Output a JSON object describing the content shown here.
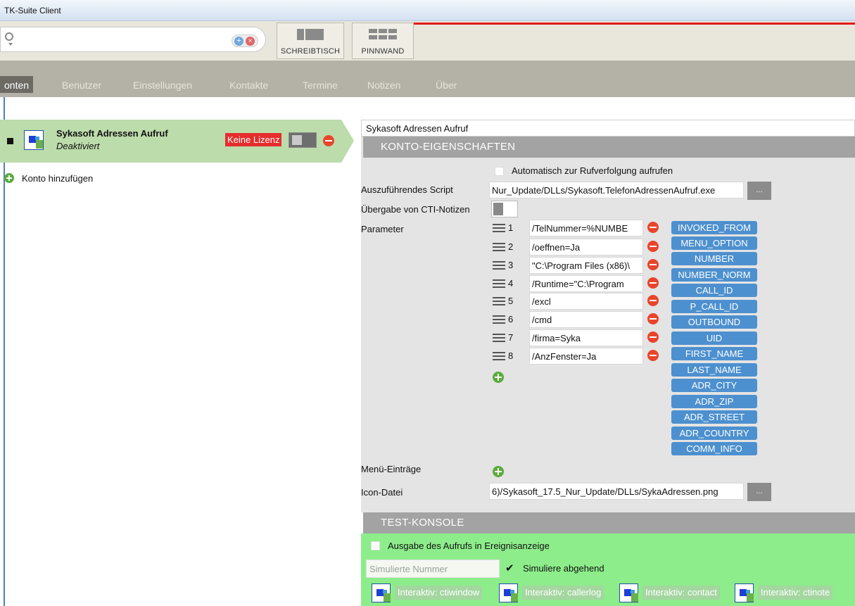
{
  "window": {
    "title": "TK-Suite Client"
  },
  "toolbar": {
    "view_buttons": [
      {
        "label": "SCHREIBTISCH",
        "icon": "desk-view-icon"
      },
      {
        "label": "PINNWAND",
        "icon": "pinboard-view-icon"
      }
    ],
    "search": {
      "placeholder": ""
    }
  },
  "tabs": [
    {
      "label": "onten",
      "active": true
    },
    {
      "label": "Benutzer",
      "active": false
    },
    {
      "label": "Einstellungen",
      "active": false
    },
    {
      "label": "Kontakte",
      "active": false
    },
    {
      "label": "Termine",
      "active": false
    },
    {
      "label": "Notizen",
      "active": false
    },
    {
      "label": "Über",
      "active": false
    }
  ],
  "accounts": [
    {
      "name": "Sykasoft Adressen Aufruf",
      "status": "Deaktiviert",
      "license_badge": "Keine Lizenz",
      "enabled": false
    }
  ],
  "add_account_label": "Konto hinzufügen",
  "details": {
    "title": "Sykasoft Adressen Aufruf",
    "section_header": "KONTO-EIGENSCHAFTEN",
    "auto_call_label": "Automatisch zur Rufverfolgung aufrufen",
    "script_label": "Auszuführendes Script",
    "script_value": "Nur_Update/DLLs/Sykasoft.TelefonAdressenAufruf.exe",
    "browse_label": "...",
    "cti_notes_label": "Übergabe von CTI-Notizen",
    "parameter_label": "Parameter",
    "parameters": [
      {
        "num": "1",
        "value": "/TelNummer=%NUMBE"
      },
      {
        "num": "2",
        "value": "/oeffnen=Ja"
      },
      {
        "num": "3",
        "value": "\"C:\\Program Files (x86)\\"
      },
      {
        "num": "4",
        "value": "/Runtime=\"C:\\Program"
      },
      {
        "num": "5",
        "value": "/excl"
      },
      {
        "num": "6",
        "value": "/cmd"
      },
      {
        "num": "7",
        "value": "/firma=Syka"
      },
      {
        "num": "8",
        "value": "/AnzFenster=Ja"
      }
    ],
    "variables": [
      "INVOKED_FROM",
      "MENU_OPTION",
      "NUMBER",
      "NUMBER_NORM",
      "CALL_ID",
      "P_CALL_ID",
      "OUTBOUND",
      "UID",
      "FIRST_NAME",
      "LAST_NAME",
      "ADR_CITY",
      "ADR_ZIP",
      "ADR_STREET",
      "ADR_COUNTRY",
      "COMM_INFO"
    ],
    "menu_entries_label": "Menü-Einträge",
    "icon_file_label": "Icon-Datei",
    "icon_file_value": "6)/Sykasoft_17.5_Nur_Update/DLLs/SykaAdressen.png"
  },
  "test_console": {
    "header": "TEST-KONSOLE",
    "output_label": "Ausgabe des Aufrufs in Ereignisanzeige",
    "simulated_number_placeholder": "Simulierte Nummer",
    "simulate_outbound_label": "Simuliere abgehend",
    "buttons": [
      "Interaktiv: ctiwindow",
      "Interaktiv: callerlog",
      "Interaktiv: contact",
      "Interaktiv: ctinote"
    ]
  },
  "colors": {
    "accent_red": "#e31b1b",
    "account_selected": "#bcdcab",
    "tag_blue": "#4d90cf",
    "test_green": "#8ded8a"
  }
}
